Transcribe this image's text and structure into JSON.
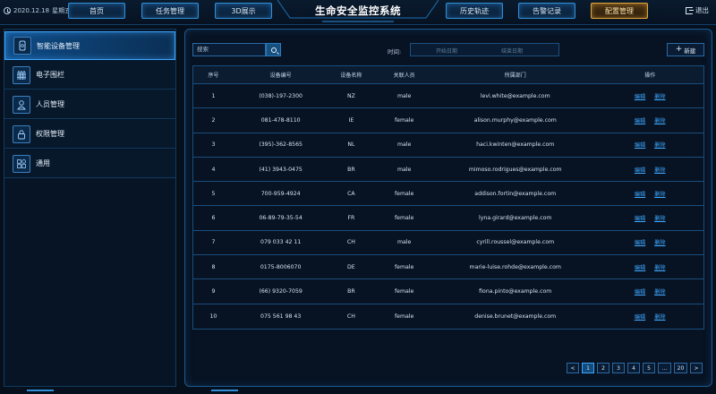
{
  "header": {
    "date": "2020.12.18",
    "weekday": "星期五",
    "title": "生命安全监控系统",
    "logout_label": "退出",
    "nav": [
      {
        "label": "首页"
      },
      {
        "label": "任务管理"
      },
      {
        "label": "3D展示"
      },
      {
        "label": "历史轨迹"
      },
      {
        "label": "告警记录"
      },
      {
        "label": "配置管理",
        "active": true
      }
    ]
  },
  "sidebar": {
    "items": [
      {
        "label": "智能设备管理",
        "icon": "device-icon",
        "active": true
      },
      {
        "label": "电子围栏",
        "icon": "fence-icon"
      },
      {
        "label": "人员管理",
        "icon": "user-icon"
      },
      {
        "label": "权限管理",
        "icon": "lock-icon"
      },
      {
        "label": "通用",
        "icon": "grid-icon"
      }
    ]
  },
  "toolbar": {
    "search_placeholder": "搜索",
    "time_label": "时间:",
    "start_date_placeholder": "开始日期",
    "end_date_placeholder": "结束日期",
    "new_label": "新建"
  },
  "table": {
    "headers": [
      "序号",
      "设备编号",
      "设备名称",
      "关联人员",
      "所属部门",
      "操作"
    ],
    "edit_label": "编辑",
    "delete_label": "删除",
    "rows": [
      [
        "1",
        "(038)-197-2300",
        "NZ",
        "male",
        "levi.white@example.com"
      ],
      [
        "2",
        "081-478-8110",
        "IE",
        "female",
        "alison.murphy@example.com"
      ],
      [
        "3",
        "(395)-362-8565",
        "NL",
        "male",
        "haci.kwinten@example.com"
      ],
      [
        "4",
        "(41) 3943-0475",
        "BR",
        "male",
        "mimoso.rodrigues@example.com"
      ],
      [
        "5",
        "700-959-4924",
        "CA",
        "female",
        "addison.fortin@example.com"
      ],
      [
        "6",
        "06-89-79-35-54",
        "FR",
        "female",
        "lyna.girard@example.com"
      ],
      [
        "7",
        "079 033 42 11",
        "CH",
        "male",
        "cyrill.roussel@example.com"
      ],
      [
        "8",
        "0175-8006070",
        "DE",
        "female",
        "marie-luise.rohde@example.com"
      ],
      [
        "9",
        "(66) 9320-7059",
        "BR",
        "female",
        "fiona.pinto@example.com"
      ],
      [
        "10",
        "075 561 98 43",
        "CH",
        "female",
        "denise.brunet@example.com"
      ]
    ]
  },
  "pagination": {
    "prev": "<",
    "next": ">",
    "pages": [
      "1",
      "2",
      "3",
      "4",
      "5",
      "...",
      "20"
    ],
    "current": "1"
  },
  "colors": {
    "accent": "#3ea8ff",
    "active_nav": "#e0a63a",
    "background": "#05101c"
  }
}
